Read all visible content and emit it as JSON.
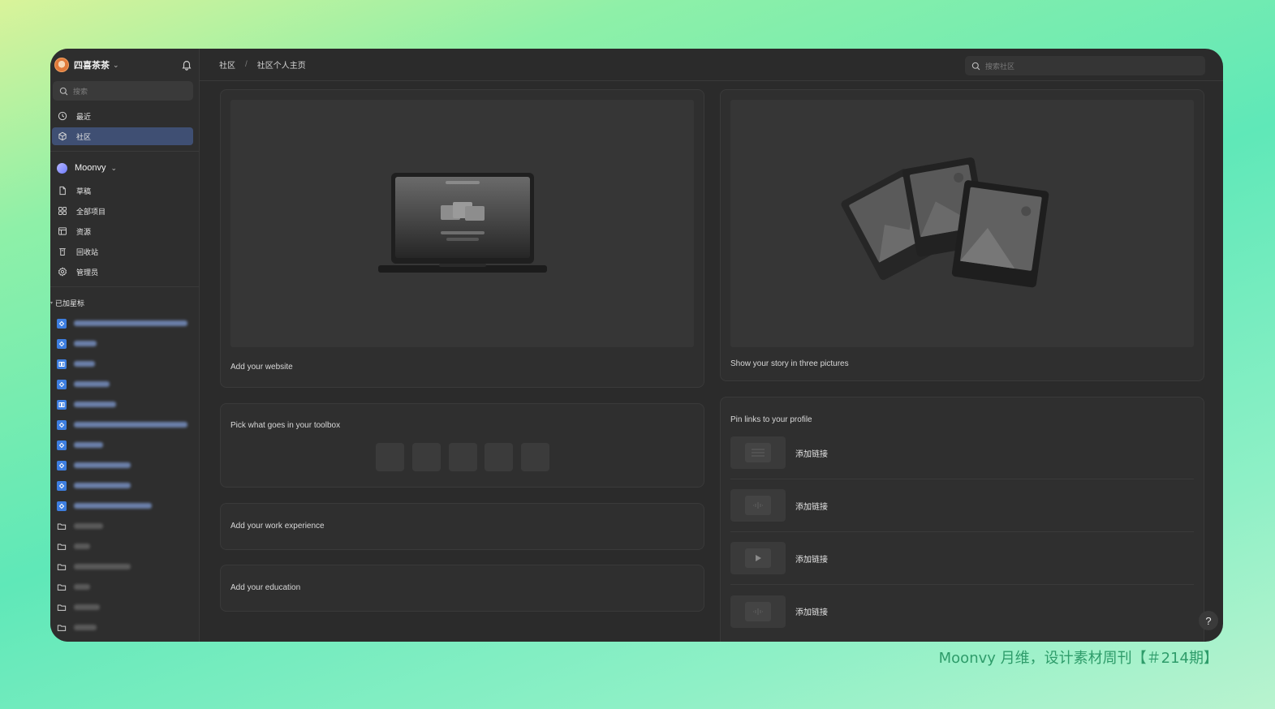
{
  "workspace": {
    "name": "四喜茶茶"
  },
  "sidebar": {
    "search_placeholder": "搜索",
    "primary": [
      {
        "label": "最近",
        "icon": "clock-icon"
      },
      {
        "label": "社区",
        "icon": "community-cube-icon",
        "active": true
      }
    ],
    "team": {
      "name": "Moonvy"
    },
    "team_items": [
      {
        "label": "草稿",
        "icon": "file-icon"
      },
      {
        "label": "全部项目",
        "icon": "grid-icon"
      },
      {
        "label": "资源",
        "icon": "layout-icon"
      },
      {
        "label": "回收站",
        "icon": "trash-icon"
      },
      {
        "label": "管理员",
        "icon": "gear-icon"
      }
    ],
    "starred_title": "已加星标"
  },
  "breadcrumb": {
    "root": "社区",
    "separator": "/",
    "current": "社区个人主页"
  },
  "top_search": {
    "placeholder": "搜索社区"
  },
  "cards": {
    "website": "Add your website",
    "story": "Show your story in three pictures",
    "toolbox": "Pick what goes in your toolbox",
    "work": "Add your work experience",
    "education": "Add your education",
    "links_title": "Pin links to your profile",
    "links": [
      "添加链接",
      "添加链接",
      "添加链接",
      "添加链接"
    ]
  },
  "help": "?",
  "footer": {
    "caption": "Moonvy 月维，设计素材周刊【＃214期】"
  },
  "colors": {
    "active_nav": "#3f4f73",
    "file_blue": "#3d7ee0",
    "frame_bg": "#2b2b2b"
  }
}
